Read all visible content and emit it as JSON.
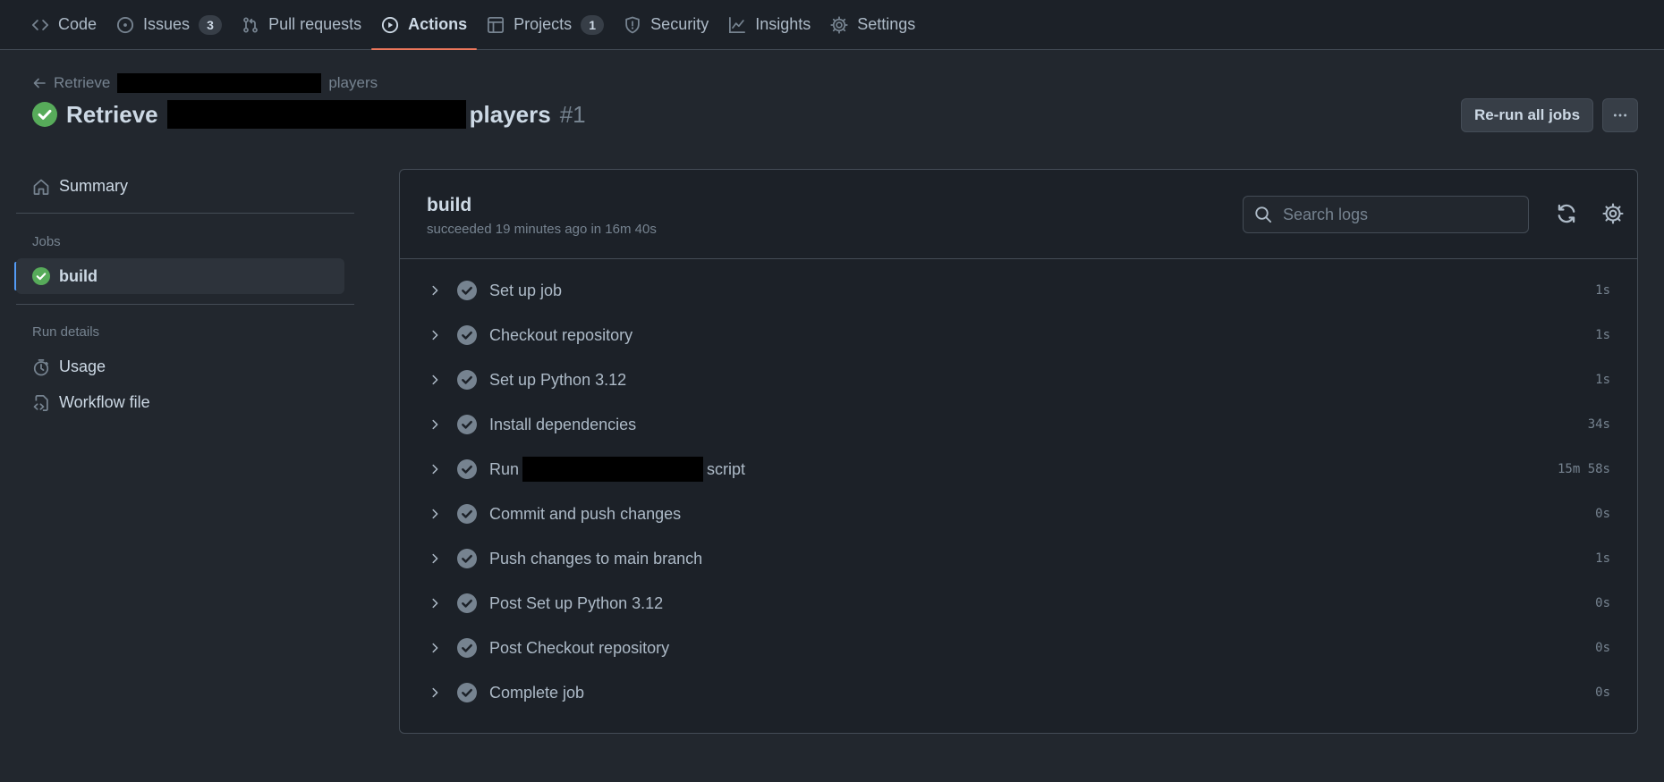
{
  "nav": {
    "tabs": [
      {
        "label": "Code",
        "icon": "code-icon"
      },
      {
        "label": "Issues",
        "icon": "issue-opened-icon",
        "count": "3"
      },
      {
        "label": "Pull requests",
        "icon": "git-pull-request-icon"
      },
      {
        "label": "Actions",
        "icon": "play-icon",
        "selected": true
      },
      {
        "label": "Projects",
        "icon": "table-icon",
        "count": "1"
      },
      {
        "label": "Security",
        "icon": "shield-icon"
      },
      {
        "label": "Insights",
        "icon": "graph-icon"
      },
      {
        "label": "Settings",
        "icon": "gear-icon"
      }
    ]
  },
  "header": {
    "back_prefix": "Retrieve",
    "back_suffix": "players",
    "title_prefix": "Retrieve",
    "title_suffix": "players",
    "run_number": "#1",
    "rerun_label": "Re-run all jobs",
    "more_icon": "kebab-horizontal-icon"
  },
  "sidebar": {
    "summary_label": "Summary",
    "jobs_heading": "Jobs",
    "job_label": "build",
    "run_details_heading": "Run details",
    "usage_label": "Usage",
    "workflow_label": "Workflow file"
  },
  "job": {
    "name": "build",
    "status": "succeeded 19 minutes ago in 16m 40s",
    "search_placeholder": "Search logs",
    "steps": [
      {
        "label": "Set up job",
        "duration": "1s"
      },
      {
        "label": "Checkout repository",
        "duration": "1s"
      },
      {
        "label": "Set up Python 3.12",
        "duration": "1s"
      },
      {
        "label": "Install dependencies",
        "duration": "34s"
      },
      {
        "label_prefix": "Run",
        "label_suffix": "script",
        "duration": "15m 58s"
      },
      {
        "label": "Commit and push changes",
        "duration": "0s"
      },
      {
        "label": "Push changes to main branch",
        "duration": "1s"
      },
      {
        "label": "Post Set up Python 3.12",
        "duration": "0s"
      },
      {
        "label": "Post Checkout repository",
        "duration": "0s"
      },
      {
        "label": "Complete job",
        "duration": "0s"
      }
    ]
  },
  "colors": {
    "accent_underline": "#ec775c",
    "success": "#57ab5a",
    "selected_bar": "#539bf5"
  }
}
